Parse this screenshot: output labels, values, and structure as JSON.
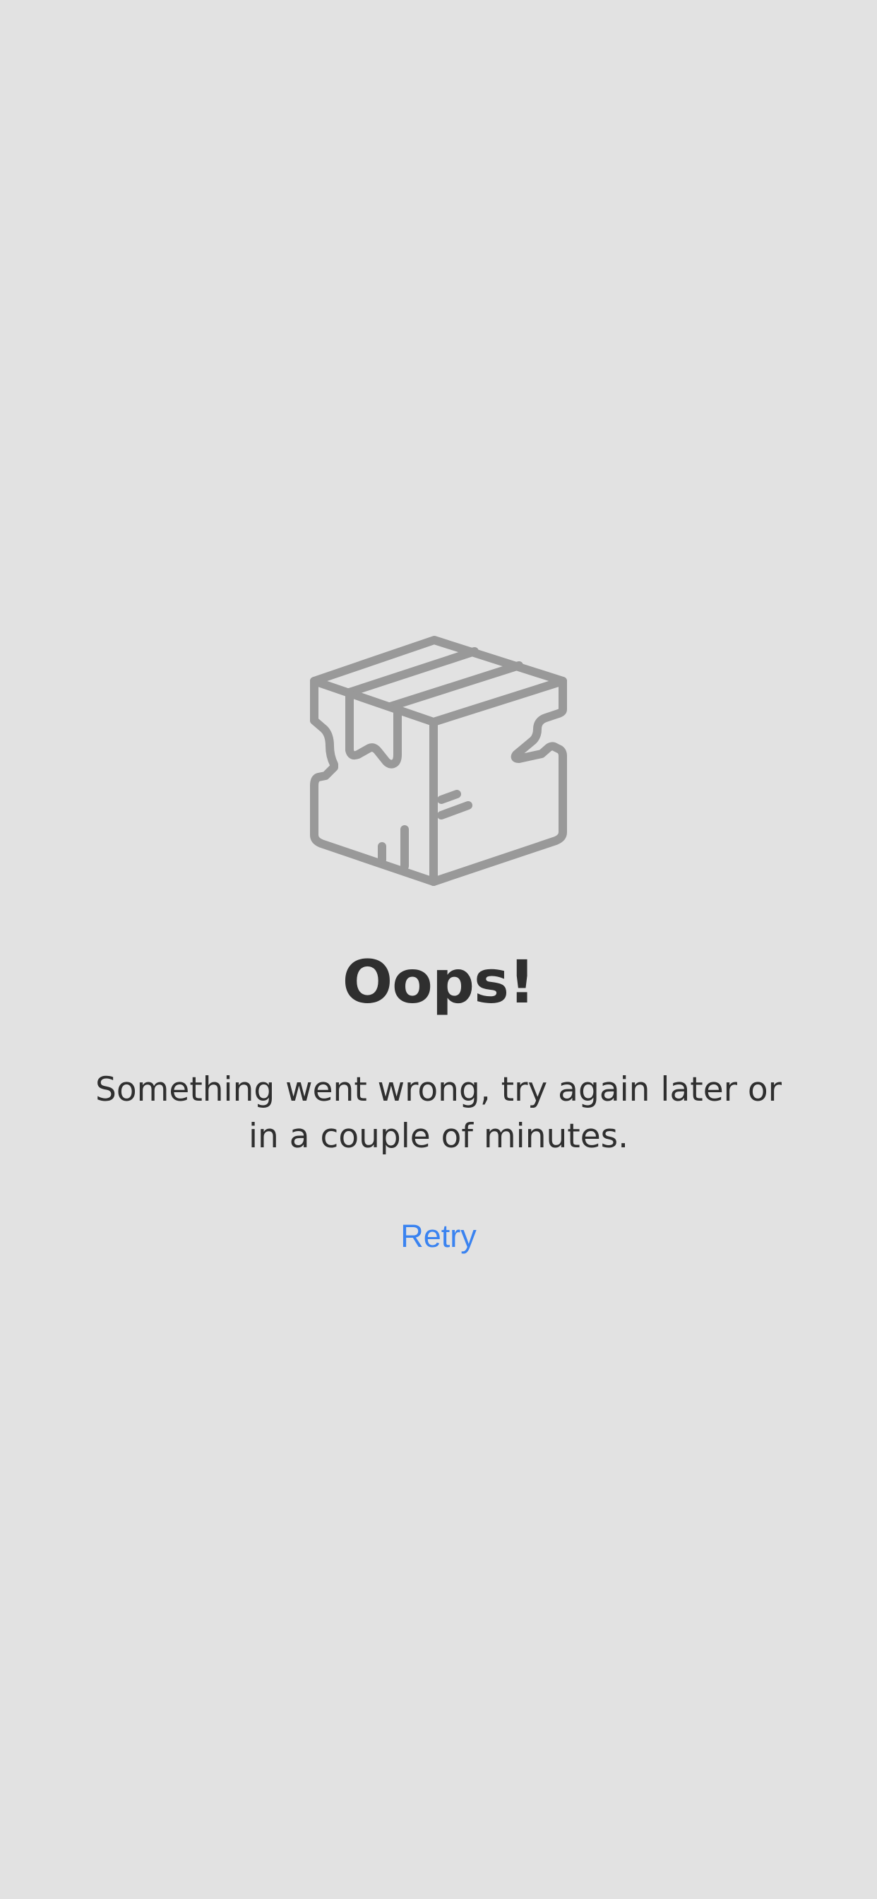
{
  "error": {
    "icon": "broken-box-icon",
    "title": "Oops!",
    "message": "Something went wrong, try again later or in a couple of minutes.",
    "retry_label": "Retry"
  },
  "colors": {
    "background": "#e2e2e2",
    "icon": "#999999",
    "text": "#2f2f2f",
    "accent": "#3a83f0"
  }
}
